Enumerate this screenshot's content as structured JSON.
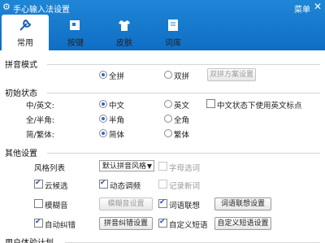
{
  "window": {
    "title": "手心输入法设置",
    "menu_label": "菜单"
  },
  "tabs": [
    {
      "label": "常用",
      "active": true,
      "icon": "wrench-icon"
    },
    {
      "label": "按键",
      "active": false,
      "icon": "keyboard-icon"
    },
    {
      "label": "皮肤",
      "active": false,
      "icon": "tshirt-icon"
    },
    {
      "label": "词库",
      "active": false,
      "icon": "book-icon"
    }
  ],
  "sections": {
    "pinyin": {
      "title": "拼音模式",
      "quanpin": "全拼",
      "shuangpin": "双拼",
      "scheme_button": "双拼方案设置"
    },
    "initial": {
      "title": "初始状态",
      "cn_en": {
        "label": "中/英文:",
        "opt1": "中文",
        "opt2": "英文",
        "check": "中文状态下使用英文标点"
      },
      "width": {
        "label": "全/半角:",
        "opt1": "半角",
        "opt2": "全角"
      },
      "trad": {
        "label": "简/繁体:",
        "opt1": "简体",
        "opt2": "繁体"
      }
    },
    "other": {
      "title": "其他设置",
      "style_label": "风格列表",
      "style_value": "默认拼音风格",
      "letter_input": "字母选词",
      "cloud": "云候选",
      "dynamic": "动态调频",
      "record_new": "记录新词",
      "fuzzy": "模糊音",
      "fuzzy_button": "模糊音设置",
      "assoc": "词语联想",
      "assoc_button": "词语联想设置",
      "auto_correct": "自动纠错",
      "correct_button": "拼音纠错设置",
      "custom_phrase": "自定义短语",
      "custom_button": "自定义短语设置"
    },
    "user_plan": {
      "title": "用户体验计划"
    }
  }
}
